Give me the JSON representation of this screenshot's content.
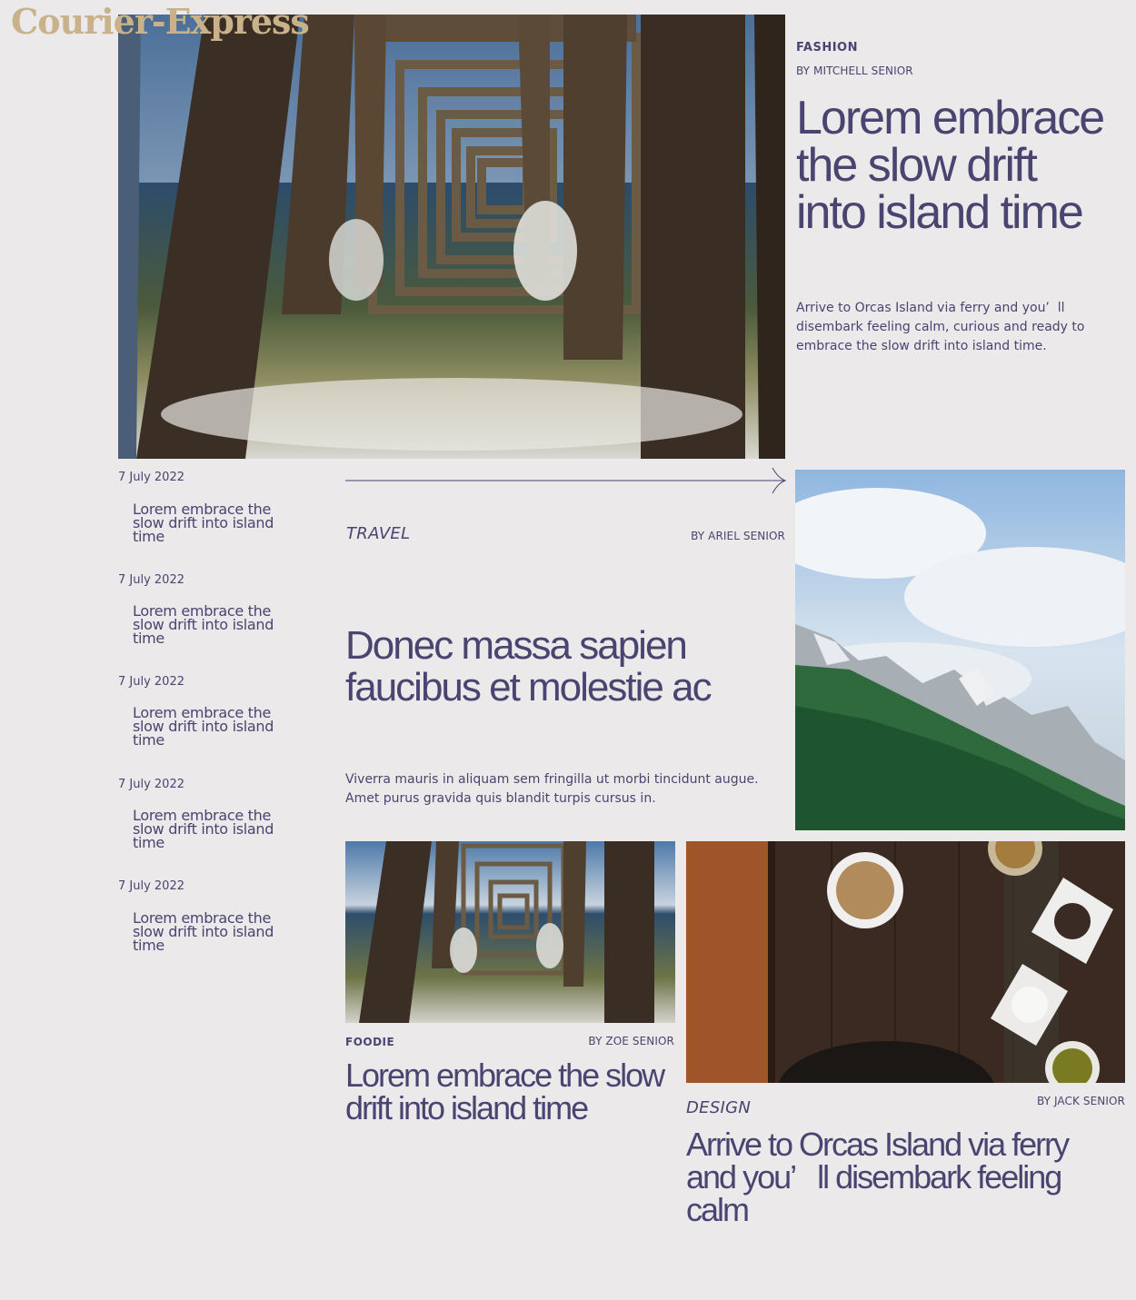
{
  "brand": {
    "logo_text": "Courier-Express"
  },
  "feature": {
    "category": "FASHION",
    "byline": "BY MITCHELL SENIOR",
    "title": "Lorem embrace the slow drift into island time",
    "excerpt": "Arrive to Orcas Island via ferry and you’  ll disembark feeling calm, curious and ready to embrace the slow drift into island time.",
    "image_icon": "pier-photo"
  },
  "sidebar": {
    "items": [
      {
        "date": "7 July 2022",
        "title": "Lorem embrace the slow drift into island time"
      },
      {
        "date": "7 July 2022",
        "title": "Lorem embrace the slow drift into island time"
      },
      {
        "date": "7 July 2022",
        "title": "Lorem embrace the slow drift into island time"
      },
      {
        "date": "7 July 2022",
        "title": "Lorem embrace the slow drift into island time"
      },
      {
        "date": "7 July 2022",
        "title": "Lorem embrace the slow drift into island time"
      }
    ]
  },
  "travel": {
    "category": "TRAVEL",
    "byline": "BY ARIEL SENIOR",
    "title": "Donec massa sapien faucibus et molestie ac",
    "excerpt": "Viverra mauris in aliquam sem fringilla ut morbi tincidunt augue. Amet purus gravida quis blandit turpis cursus in.",
    "image_icon": "mountain-photo"
  },
  "foodie": {
    "category": "FOODIE",
    "byline": "BY ZOE SENIOR",
    "title": "Lorem embrace the slow drift into island time",
    "image_icon": "pier-photo"
  },
  "design": {
    "category": "DESIGN",
    "byline": "BY JACK SENIOR",
    "title": "Arrive to Orcas Island via ferry and you’   ll disembark feeling calm",
    "image_icon": "spices-photo"
  },
  "colors": {
    "background": "#ebe9ea",
    "text": "#4a4470",
    "logo": "#c9b18a"
  }
}
